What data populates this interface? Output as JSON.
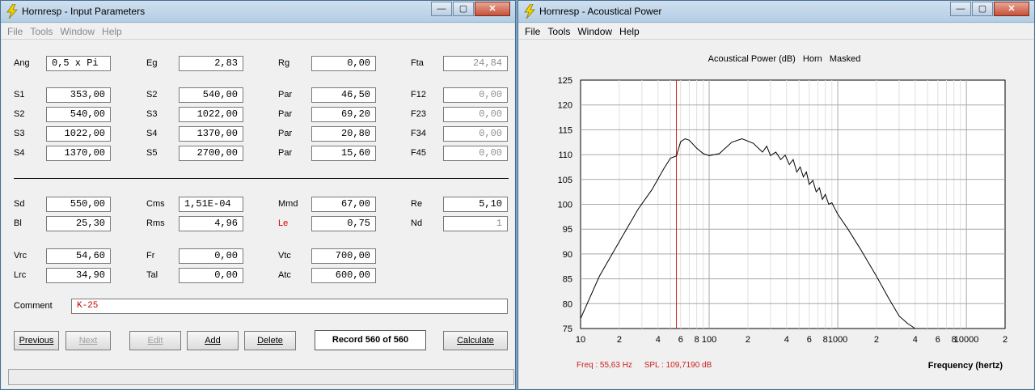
{
  "left_window": {
    "title": "Hornresp - Input Parameters",
    "controls": {
      "minimize": "—",
      "maximize": "▢",
      "close": "✕"
    },
    "menu": [
      "File",
      "Tools",
      "Window",
      "Help"
    ],
    "rows": [
      [
        {
          "label": "Ang",
          "value": "0,5 x Pi",
          "align": "left"
        },
        {
          "label": "Eg",
          "value": "2,83"
        },
        {
          "label": "Rg",
          "value": "0,00"
        },
        {
          "label": "Fta",
          "value": "24,84",
          "ro": true
        }
      ],
      [
        {
          "label": "S1",
          "value": "353,00"
        },
        {
          "label": "S2",
          "value": "540,00"
        },
        {
          "label": "Par",
          "value": "46,50"
        },
        {
          "label": "F12",
          "value": "0,00",
          "ro": true
        }
      ],
      [
        {
          "label": "S2",
          "value": "540,00"
        },
        {
          "label": "S3",
          "value": "1022,00"
        },
        {
          "label": "Par",
          "value": "69,20"
        },
        {
          "label": "F23",
          "value": "0,00",
          "ro": true
        }
      ],
      [
        {
          "label": "S3",
          "value": "1022,00"
        },
        {
          "label": "S4",
          "value": "1370,00"
        },
        {
          "label": "Par",
          "value": "20,80"
        },
        {
          "label": "F34",
          "value": "0,00",
          "ro": true
        }
      ],
      [
        {
          "label": "S4",
          "value": "1370,00"
        },
        {
          "label": "S5",
          "value": "2700,00"
        },
        {
          "label": "Par",
          "value": "15,60"
        },
        {
          "label": "F45",
          "value": "0,00",
          "ro": true
        }
      ],
      [
        {
          "label": "Sd",
          "value": "550,00"
        },
        {
          "label": "Cms",
          "value": "1,51E-04",
          "align": "left"
        },
        {
          "label": "Mmd",
          "value": "67,00"
        },
        {
          "label": "Re",
          "value": "5,10"
        }
      ],
      [
        {
          "label": "Bl",
          "value": "25,30"
        },
        {
          "label": "Rms",
          "value": "4,96"
        },
        {
          "label": "Le",
          "value": "0,75",
          "red": true
        },
        {
          "label": "Nd",
          "value": "1",
          "ro": true
        }
      ],
      [
        {
          "label": "Vrc",
          "value": "54,60"
        },
        {
          "label": "Fr",
          "value": "0,00"
        },
        {
          "label": "Vtc",
          "value": "700,00"
        }
      ],
      [
        {
          "label": "Lrc",
          "value": "34,90"
        },
        {
          "label": "Tal",
          "value": "0,00"
        },
        {
          "label": "Atc",
          "value": "600,00"
        }
      ]
    ],
    "comment_label": "Comment",
    "comment_value": "K-25",
    "buttons": {
      "previous": "Previous",
      "next": "Next",
      "edit": "Edit",
      "add": "Add",
      "delete": "Delete",
      "calculate": "Calculate"
    },
    "record": "Record 560 of 560"
  },
  "right_window": {
    "title": "Hornresp - Acoustical Power",
    "controls": {
      "minimize": "—",
      "maximize": "▢",
      "close": "✕"
    },
    "menu": [
      "File",
      "Tools",
      "Window",
      "Help"
    ],
    "chart_title_parts": [
      "Acoustical Power (dB)",
      "Horn",
      "Masked"
    ],
    "readout_freq": "Freq : 55,63 Hz",
    "readout_spl": "SPL : 109,7190 dB",
    "x_axis_label": "Frequency (hertz)"
  },
  "colors": {
    "cursor": "#cc2222",
    "curve": "#000000",
    "grid_major": "#a8a8a8",
    "grid_minor": "#e0e0e0",
    "label_red": "#cc0000"
  },
  "chart_data": {
    "type": "line",
    "title": "Acoustical Power (dB)",
    "xlabel": "Frequency (hertz)",
    "ylabel": "",
    "x_scale": "log",
    "xlim": [
      10,
      20000
    ],
    "ylim": [
      75,
      125
    ],
    "grid": true,
    "y_ticks": [
      "125",
      "120",
      "115",
      "110",
      "105",
      "100",
      "95",
      "90",
      "85",
      "80",
      "75"
    ],
    "x_ticks": [
      "10",
      "2",
      "4",
      "6",
      "8",
      "100",
      "2",
      "4",
      "6",
      "8",
      "1000",
      "2",
      "4",
      "6",
      "8",
      "10000",
      "2"
    ],
    "cursor_freq": 55.63,
    "series": [
      {
        "x": [
          10,
          14,
          20,
          28,
          36,
          44,
          50,
          55.63,
          60,
          65,
          70,
          80,
          90,
          100,
          120,
          150,
          180,
          220,
          260,
          280,
          300,
          330,
          360,
          390,
          420,
          450,
          480,
          510,
          540,
          570,
          600,
          640,
          680,
          720,
          760,
          800,
          850,
          900,
          1000,
          1200,
          1500,
          2000,
          2500,
          3000,
          3500,
          4000
        ],
        "y": [
          77,
          85.5,
          92.5,
          99,
          103,
          107,
          109.3,
          109.7,
          112.6,
          113.2,
          112.9,
          111.3,
          110.2,
          109.8,
          110.2,
          112.5,
          113.2,
          112.3,
          110.5,
          111.7,
          109.8,
          110.5,
          109,
          109.9,
          108,
          109,
          106.5,
          107.5,
          105.5,
          106.5,
          104,
          104.8,
          102.5,
          103.3,
          101,
          102,
          100,
          100.3,
          98,
          95,
          91,
          85.5,
          81,
          77.5,
          76,
          75
        ]
      }
    ]
  }
}
